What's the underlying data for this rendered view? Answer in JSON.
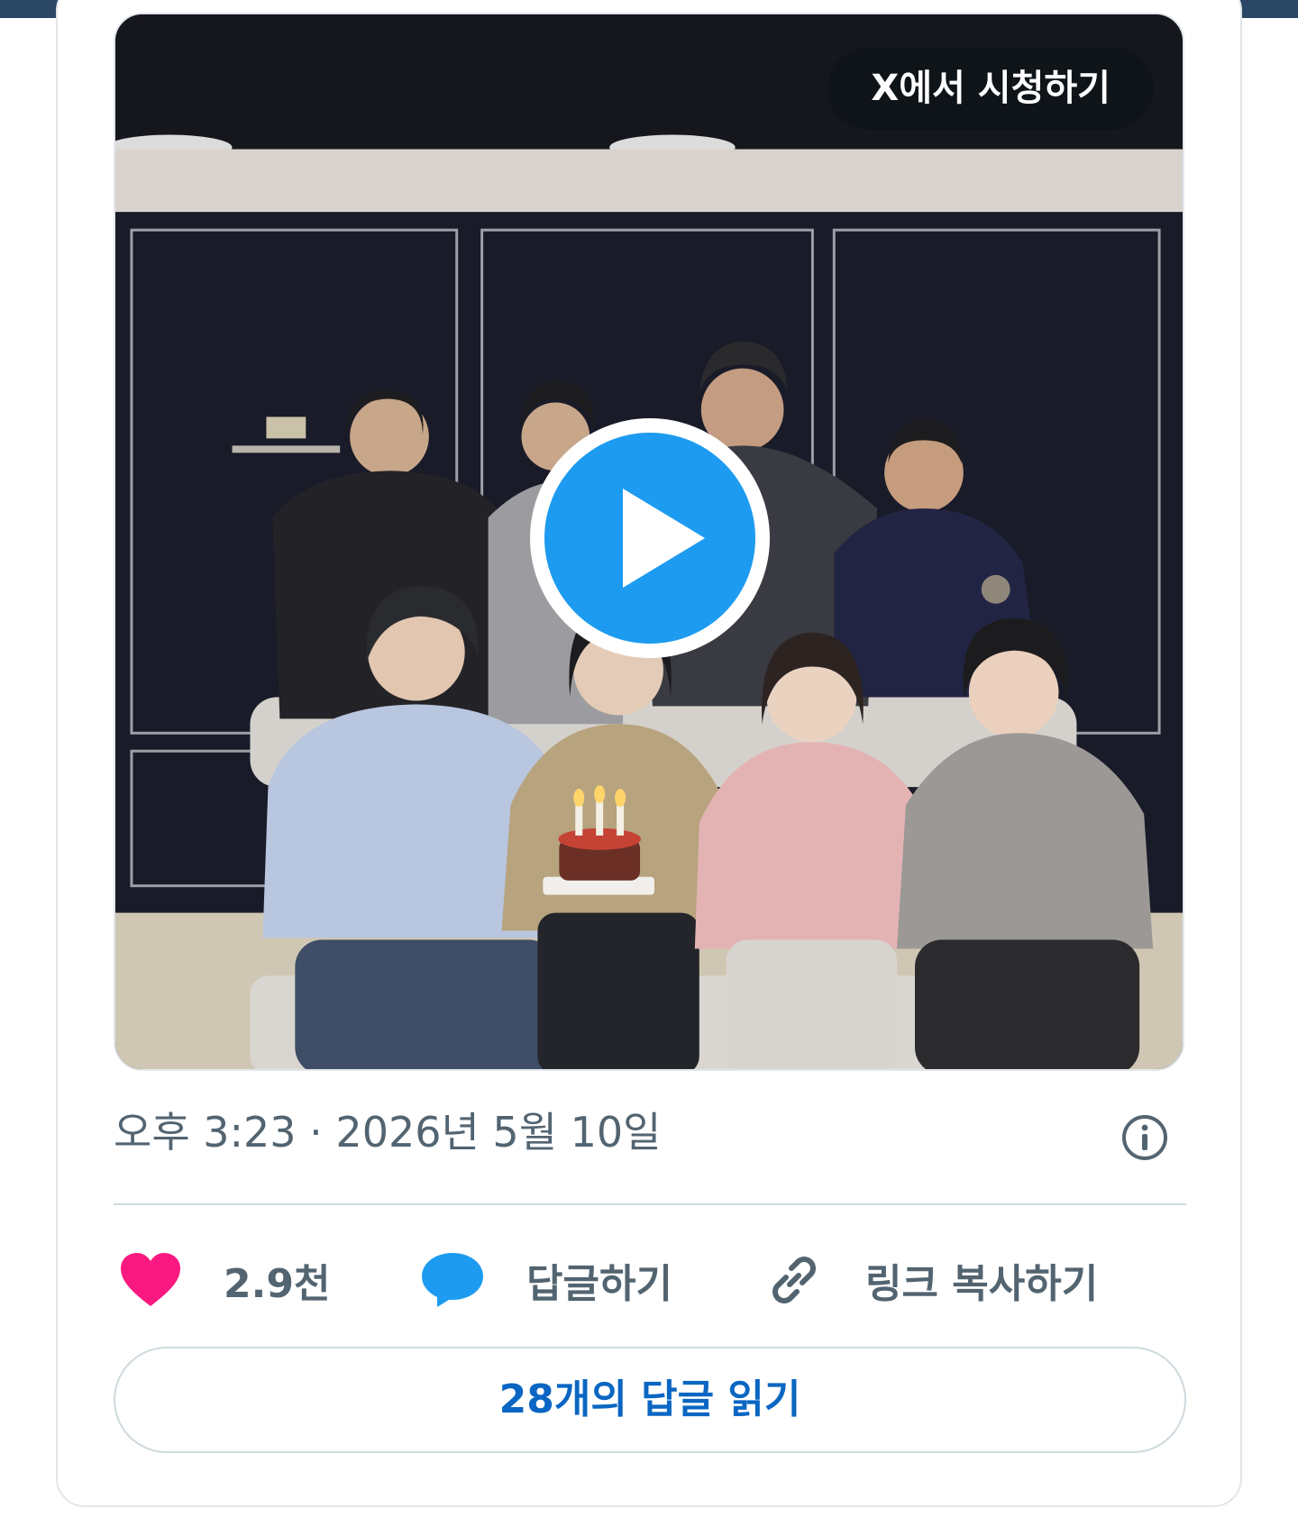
{
  "media": {
    "watch_on_x_label": "X에서 시청하기",
    "play_button": "play-icon",
    "accent_color": "#1d9bf0"
  },
  "tweet": {
    "timestamp": "오후 3:23 · 2026년 5월 10일",
    "info_icon": "info-icon"
  },
  "actions": {
    "like_count": "2.9천",
    "like_color": "#f91880",
    "reply_label": "답글하기",
    "reply_color": "#1d9bf0",
    "copy_link_label": "링크 복사하기"
  },
  "read_replies_label": "28개의 답글 읽기"
}
